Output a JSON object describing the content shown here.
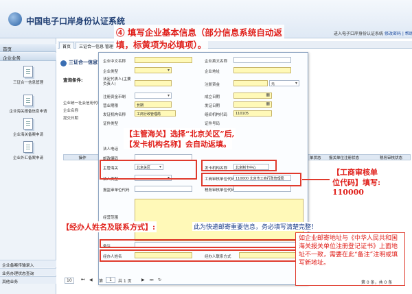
{
  "header": {
    "title": "中国电子口岸身份认证系统",
    "user": "进入电子口岸身份认证系统",
    "links": "修改密码 | 帮助"
  },
  "sidebar": {
    "head_home": "首页",
    "head_biz": "企业业务",
    "items": [
      "三证合一信息管理",
      "企业海关报备信息申请",
      "企业海关备案申请",
      "企业外汇备案申请"
    ],
    "bottom": [
      "企业备案传输录入",
      "业务办理状态查询",
      "其他业务"
    ]
  },
  "tabs": [
    "首页",
    "三证合一信息 管理"
  ],
  "breadcrumb": "三证合一信息管理",
  "query_label": "查询条件:",
  "bg_rows": [
    "企业统一社会信用代码",
    "企业名称",
    "提交日期"
  ],
  "bg_grid": {
    "left": "操作",
    "right_1": "单状态",
    "right_2": "报关单位注册状态",
    "right_3": "税务审核状态"
  },
  "form": {
    "company_cn": "企业中文名称",
    "company_en": "企业英文名称",
    "company_type": "企业类型",
    "company_addr": "企业地址",
    "legal_rep": "法定代表人(主要负责人)",
    "reg_capital": "注册资金",
    "currency": "元",
    "economic_nature": "注册资金币制",
    "establish_date": "成立日期",
    "business_term": "营业期限",
    "term_value": "长期",
    "issue_date": "发证日期",
    "issuing_authority": "发证机构名称",
    "issuing_authority_value": "工商行政管理局",
    "org_code": "组织机构代码",
    "org_code_value": "110105",
    "cert_type": "证件类型",
    "id_no": "证件号码",
    "legal_phone": "法人电话",
    "zip": "邮政编码",
    "customs": "主管海关",
    "customs_value": "北京关区",
    "issuing_org": "发卡机构名称",
    "issuing_org_value": "北京制卡中心",
    "person_type": "法人类型",
    "aic_code": "工商审核单位代码",
    "aic_code_value": "110000 北京市工商行政管理局",
    "declare_unit_code": "报监审单位代码",
    "tax_code": "税务审核单位代码",
    "scope": "经营范围",
    "remark": "备注",
    "contact_name": "经办人姓名",
    "contact_phone": "经办人联系方式"
  },
  "annotations": {
    "step4_line1": "④ 填写企业基本信息（部分信息系统自动返",
    "step4_line2": "填，标黄项为必填项）。",
    "customs_line1": "【主管海关】选择“北京关区”后,",
    "customs_line2": "【发卡机构名称】会自动返填。",
    "aic_line1": "【工商审核单",
    "aic_line2": "位代码】填写:",
    "aic_line3": "110000",
    "contact_label": "【经办人姓名及联系方式】:",
    "contact_note": "此为快递邮寄重要信息，务必填写清楚完整！",
    "remark_note": "如企业邮寄地址与《中华人民共和国海关报关单位注册登记证书》上面地址不一致，需要在此“备注”注明或填写新地址。"
  },
  "pager": {
    "size": "10",
    "page_label": "第",
    "page": "1",
    "of_label": "共 1 页",
    "summary": "第 0 条，共 0 条"
  },
  "colors": {
    "red": "#e03a2c",
    "required": "#fff9b8",
    "header_blue": "#1f3e73"
  }
}
